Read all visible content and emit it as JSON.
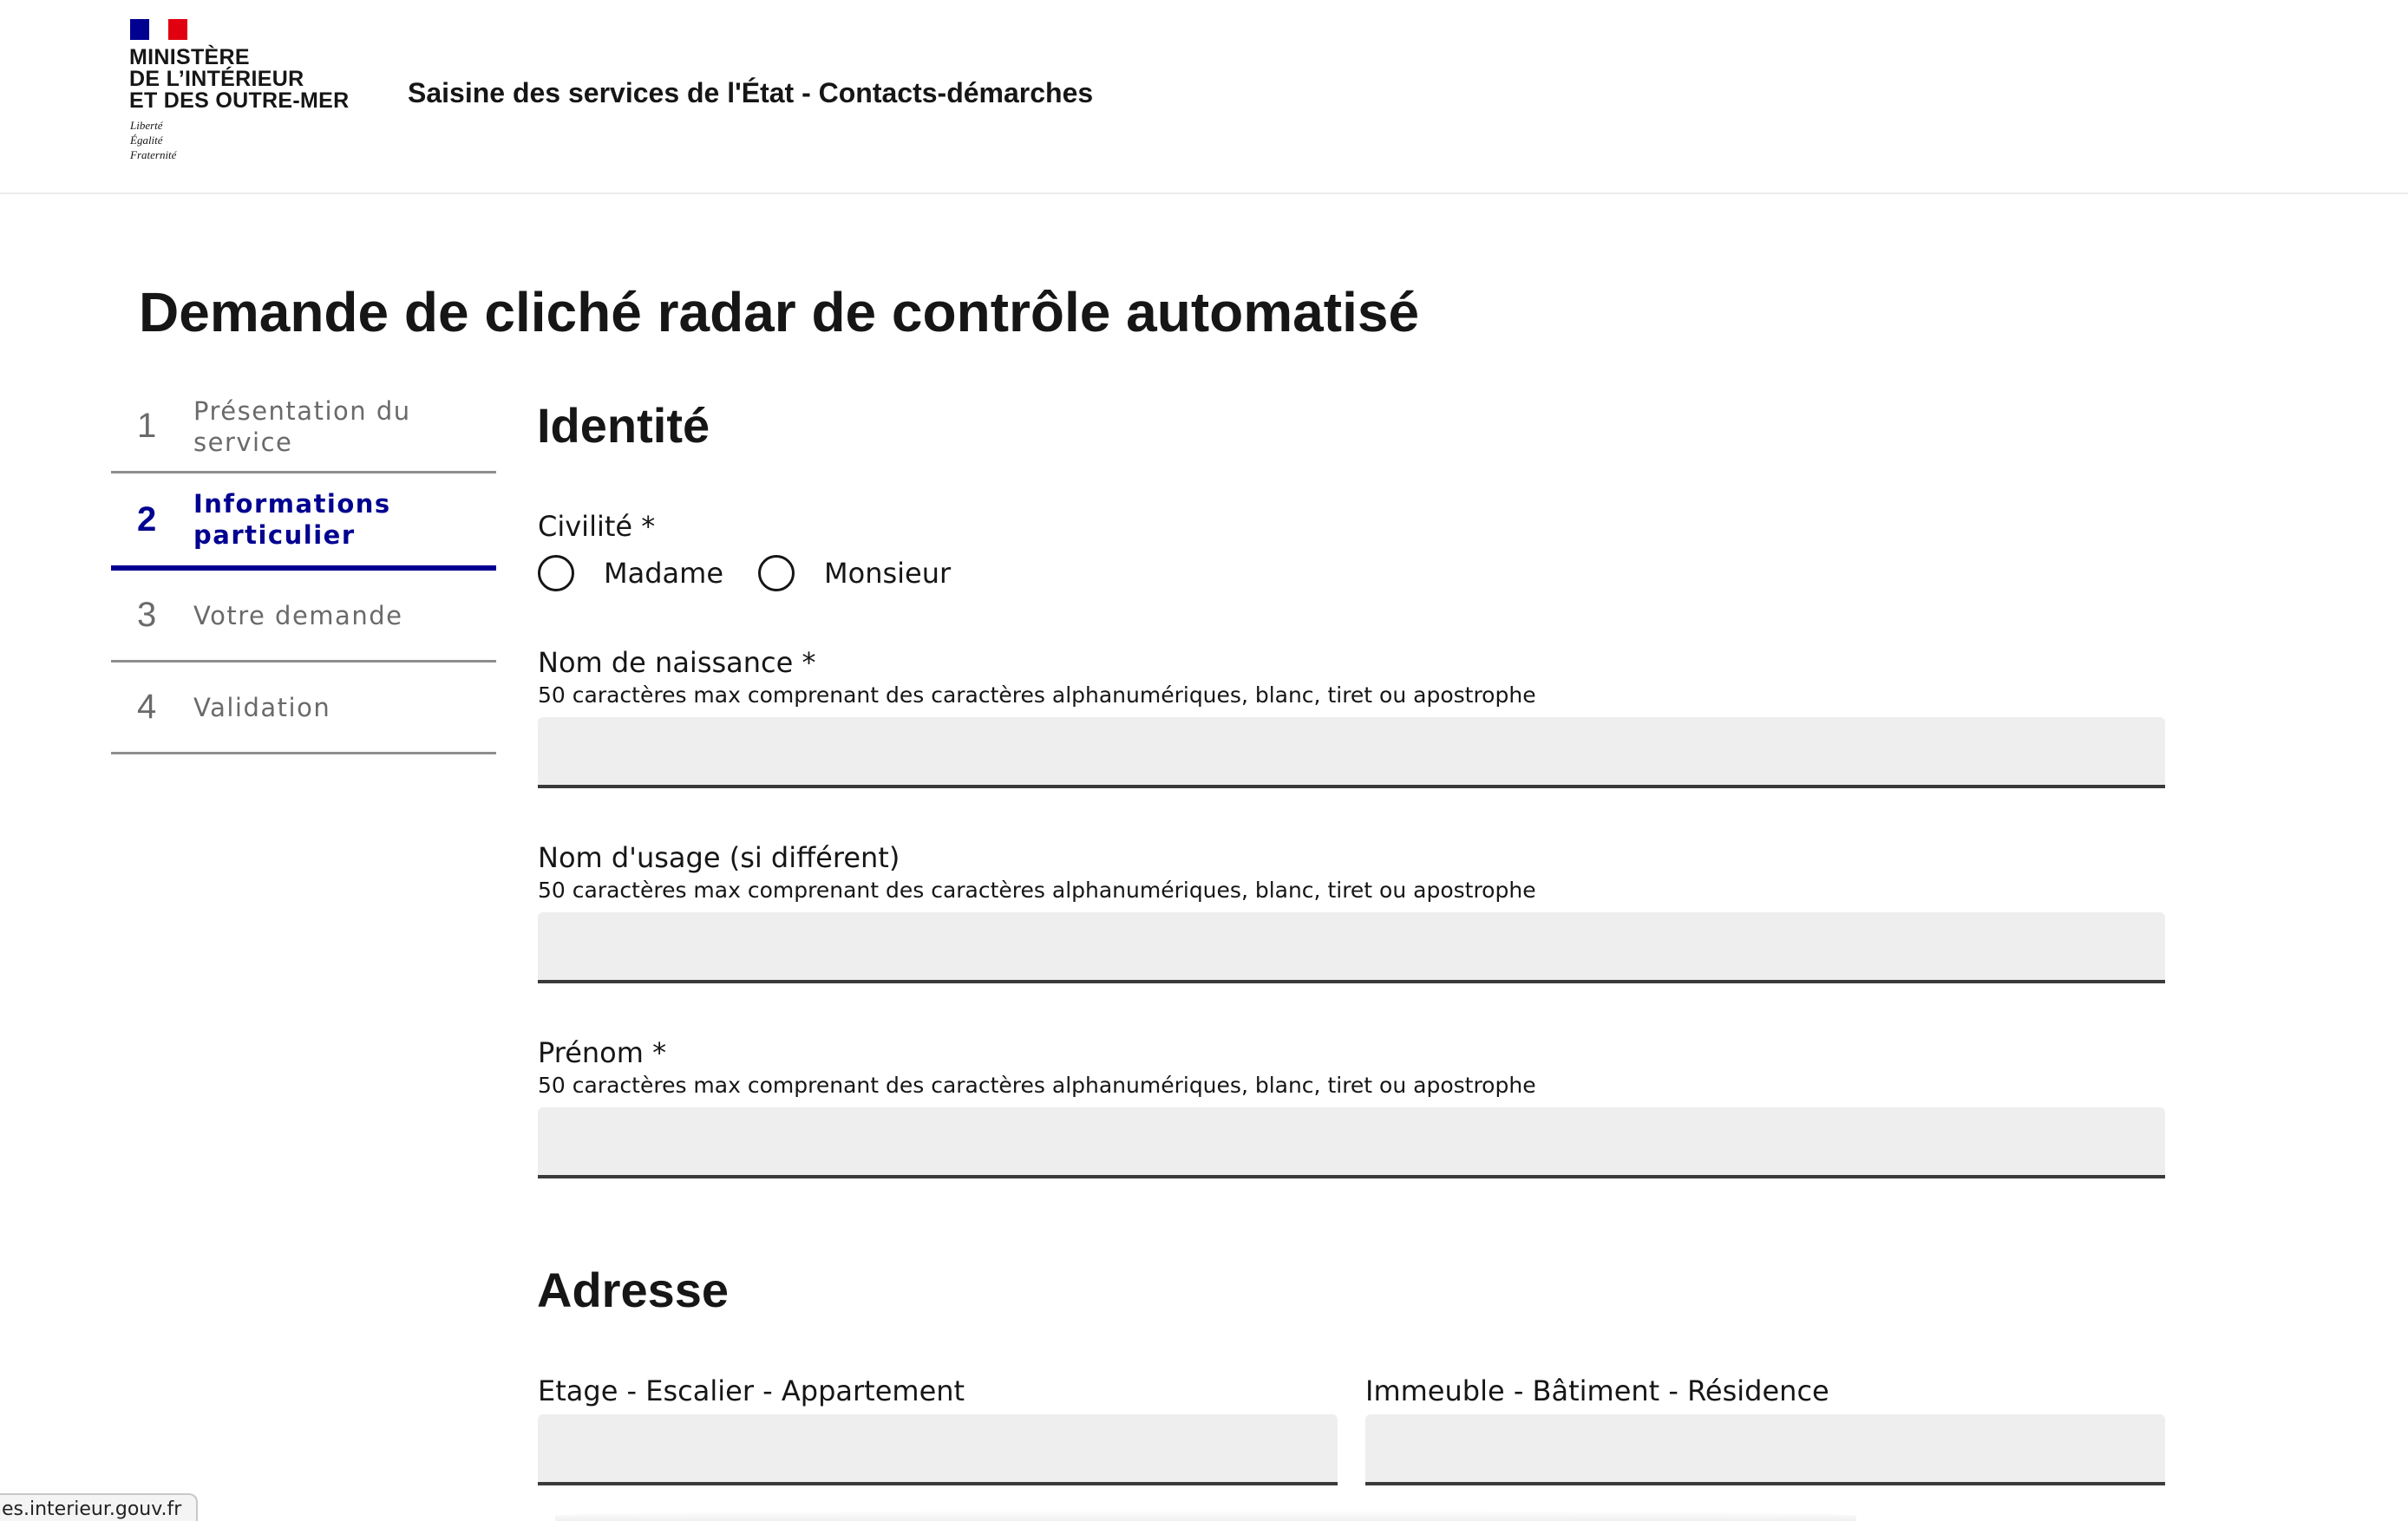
{
  "header": {
    "ministry_name": "MINISTÈRE\nDE L’INTÉRIEUR\nET DES OUTRE-MER",
    "devise": "Liberté\nÉgalité\nFraternité",
    "flag_colors": [
      "#000091",
      "#ffffff",
      "#e1000f"
    ],
    "service_title": "Saisine des services de l'État - Contacts-démarches"
  },
  "page": {
    "title": "Demande de cliché radar de contrôle automatisé"
  },
  "stepper": {
    "steps": [
      {
        "number": "1",
        "label": "Présentation du service",
        "state": "done"
      },
      {
        "number": "2",
        "label": "Informations particulier",
        "state": "current"
      },
      {
        "number": "3",
        "label": "Votre demande",
        "state": "todo"
      },
      {
        "number": "4",
        "label": "Validation",
        "state": "todo"
      }
    ],
    "active_color": "#000091"
  },
  "identite": {
    "section_title": "Identité",
    "civilite": {
      "label": "Civilité *",
      "options": [
        "Madame",
        "Monsieur"
      ],
      "selected": null
    },
    "nom_naissance": {
      "label": "Nom de naissance *",
      "hint": "50 caractères max comprenant des caractères alphanumériques, blanc, tiret ou apostrophe",
      "value": ""
    },
    "nom_usage": {
      "label": "Nom d'usage (si différent)",
      "hint": "50 caractères max comprenant des caractères alphanumériques, blanc, tiret ou apostrophe",
      "value": ""
    },
    "prenom": {
      "label": "Prénom *",
      "hint": "50 caractères max comprenant des caractères alphanumériques, blanc, tiret ou apostrophe",
      "value": ""
    }
  },
  "adresse": {
    "section_title": "Adresse",
    "etage": {
      "label": "Etage - Escalier - Appartement",
      "value": ""
    },
    "immeuble": {
      "label": "Immeuble - Bâtiment - Résidence",
      "value": ""
    }
  },
  "browser": {
    "status_url": "es.interieur.gouv.fr"
  }
}
